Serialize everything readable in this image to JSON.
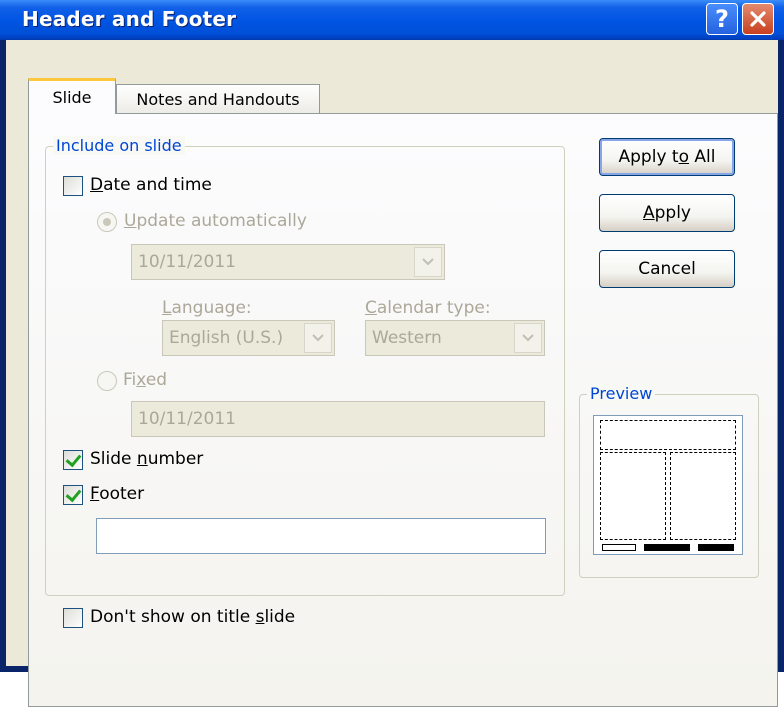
{
  "window": {
    "title": "Header and Footer",
    "help_glyph": "?",
    "close_icon": "close-icon"
  },
  "tabs": [
    {
      "label": "Slide",
      "active": true
    },
    {
      "label": "Notes and Handouts",
      "active": false
    }
  ],
  "include": {
    "group_label": "Include on slide",
    "date_time": {
      "label_pre": "",
      "label_mnemonic": "D",
      "label_post": "ate and time",
      "checked": false
    },
    "update_auto": {
      "label_mnemonic": "U",
      "label_post": "pdate automatically",
      "selected": true,
      "disabled": true
    },
    "date_value": "10/11/2011",
    "language": {
      "label_mnemonic": "L",
      "label_post": "anguage:",
      "value": "English (U.S.)"
    },
    "calendar": {
      "label_mnemonic": "C",
      "label_post": "alendar type:",
      "value": "Western"
    },
    "fixed": {
      "label_pre": "Fi",
      "label_mnemonic": "x",
      "label_post": "ed",
      "selected": false,
      "value": "10/11/2011"
    },
    "slide_number": {
      "label_pre": "Slide ",
      "label_mnemonic": "n",
      "label_post": "umber",
      "checked": true
    },
    "footer": {
      "label_mnemonic": "F",
      "label_post": "ooter",
      "checked": true,
      "value": ""
    }
  },
  "dont_show": {
    "label_pre": "Don't show on title ",
    "label_mnemonic": "s",
    "label_post": "lide",
    "checked": false
  },
  "buttons": {
    "apply_all": {
      "pre": "Apply t",
      "mnemonic": "o",
      "post": " All"
    },
    "apply": {
      "pre": "",
      "mnemonic": "A",
      "post": "pply"
    },
    "cancel": "Cancel"
  },
  "preview": {
    "label": "Preview"
  },
  "colors": {
    "titlebar": "#0054e3",
    "accent_label": "#0046d5",
    "check": "#21a121",
    "dialog_bg": "#ece9d8"
  }
}
